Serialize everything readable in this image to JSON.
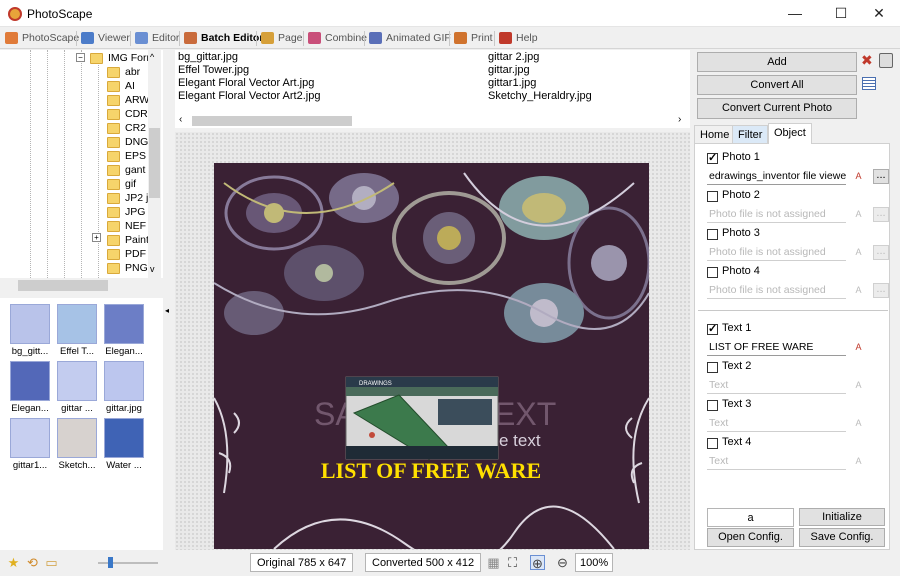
{
  "window": {
    "title": "PhotoScape",
    "min": "—",
    "max": "☐",
    "close": "✕"
  },
  "menu": [
    {
      "label": "PhotoScape",
      "color": "#e07b39"
    },
    {
      "label": "Viewer",
      "color": "#4c7cc9"
    },
    {
      "label": "Editor",
      "color": "#6a8fd3"
    },
    {
      "label": "Batch Editor",
      "color": "#c96b3c",
      "active": true
    },
    {
      "label": "Page",
      "color": "#d6a03a"
    },
    {
      "label": "Combine",
      "color": "#c94f7a"
    },
    {
      "label": "Animated GIF",
      "color": "#5a6fb8"
    },
    {
      "label": "Print",
      "color": "#d0732e"
    },
    {
      "label": "Help",
      "color": "#c0392b"
    }
  ],
  "tree": {
    "root": "IMG Forr",
    "items": [
      "abr",
      "AI",
      "ARW",
      "CDR",
      "CR2",
      "DNG",
      "EPS",
      "gant",
      "gif",
      "JP2 j",
      "JPG",
      "NEF",
      "Paint",
      "PDF",
      "PNG"
    ]
  },
  "thumbnails": [
    {
      "caption": "bg_gitt...",
      "color": "#b9c3ea"
    },
    {
      "caption": "Effel T...",
      "color": "#a6c2e6"
    },
    {
      "caption": "Elegan...",
      "color": "#6c7ec6"
    },
    {
      "caption": "Elegan...",
      "color": "#5368b8"
    },
    {
      "caption": "gittar ...",
      "color": "#c3ccef"
    },
    {
      "caption": "gittar.jpg",
      "color": "#bcc6ee"
    },
    {
      "caption": "gittar1...",
      "color": "#c7cff0"
    },
    {
      "caption": "Sketch...",
      "color": "#d7d2cf"
    },
    {
      "caption": "Water ...",
      "color": "#3f63b5"
    }
  ],
  "files": {
    "col1": [
      "bg_gittar.jpg",
      "Effel Tower.jpg",
      "Elegant Floral Vector Art.jpg",
      "Elegant Floral Vector Art2.jpg"
    ],
    "col2": [
      "gittar 2.jpg",
      "gittar.jpg",
      "gittar1.jpg",
      "Sketchy_Heraldry.jpg"
    ]
  },
  "canvas": {
    "overlay_text": "LIST OF FREE WARE",
    "watermark_left": "SA",
    "watermark_right": "EXT",
    "watermark_sub": "e text",
    "inset_title": "DRAWINGS"
  },
  "right": {
    "add": "Add",
    "convert_all": "Convert All",
    "convert_current": "Convert Current Photo",
    "tabs": [
      "Home",
      "Filter",
      "Object"
    ],
    "photos": [
      {
        "label": "Photo 1",
        "checked": true,
        "value": "edrawings_inventor file viewer",
        "empty": false
      },
      {
        "label": "Photo 2",
        "checked": false,
        "value": "Photo file is not assigned",
        "empty": true
      },
      {
        "label": "Photo 3",
        "checked": false,
        "value": "Photo file is not assigned",
        "empty": true
      },
      {
        "label": "Photo 4",
        "checked": false,
        "value": "Photo file is not assigned",
        "empty": true
      }
    ],
    "texts": [
      {
        "label": "Text 1",
        "checked": true,
        "value": "LIST OF FREE WARE",
        "empty": false
      },
      {
        "label": "Text 2",
        "checked": false,
        "value": "Text",
        "empty": true
      },
      {
        "label": "Text 3",
        "checked": false,
        "value": "Text",
        "empty": true
      },
      {
        "label": "Text 4",
        "checked": false,
        "value": "Text",
        "empty": true
      }
    ],
    "a_field": "a",
    "initialize": "Initialize",
    "open_config": "Open Config.",
    "save_config": "Save Config."
  },
  "status": {
    "original": "Original 785 x 647",
    "converted": "Converted 500 x 412",
    "zoom": "100%"
  }
}
